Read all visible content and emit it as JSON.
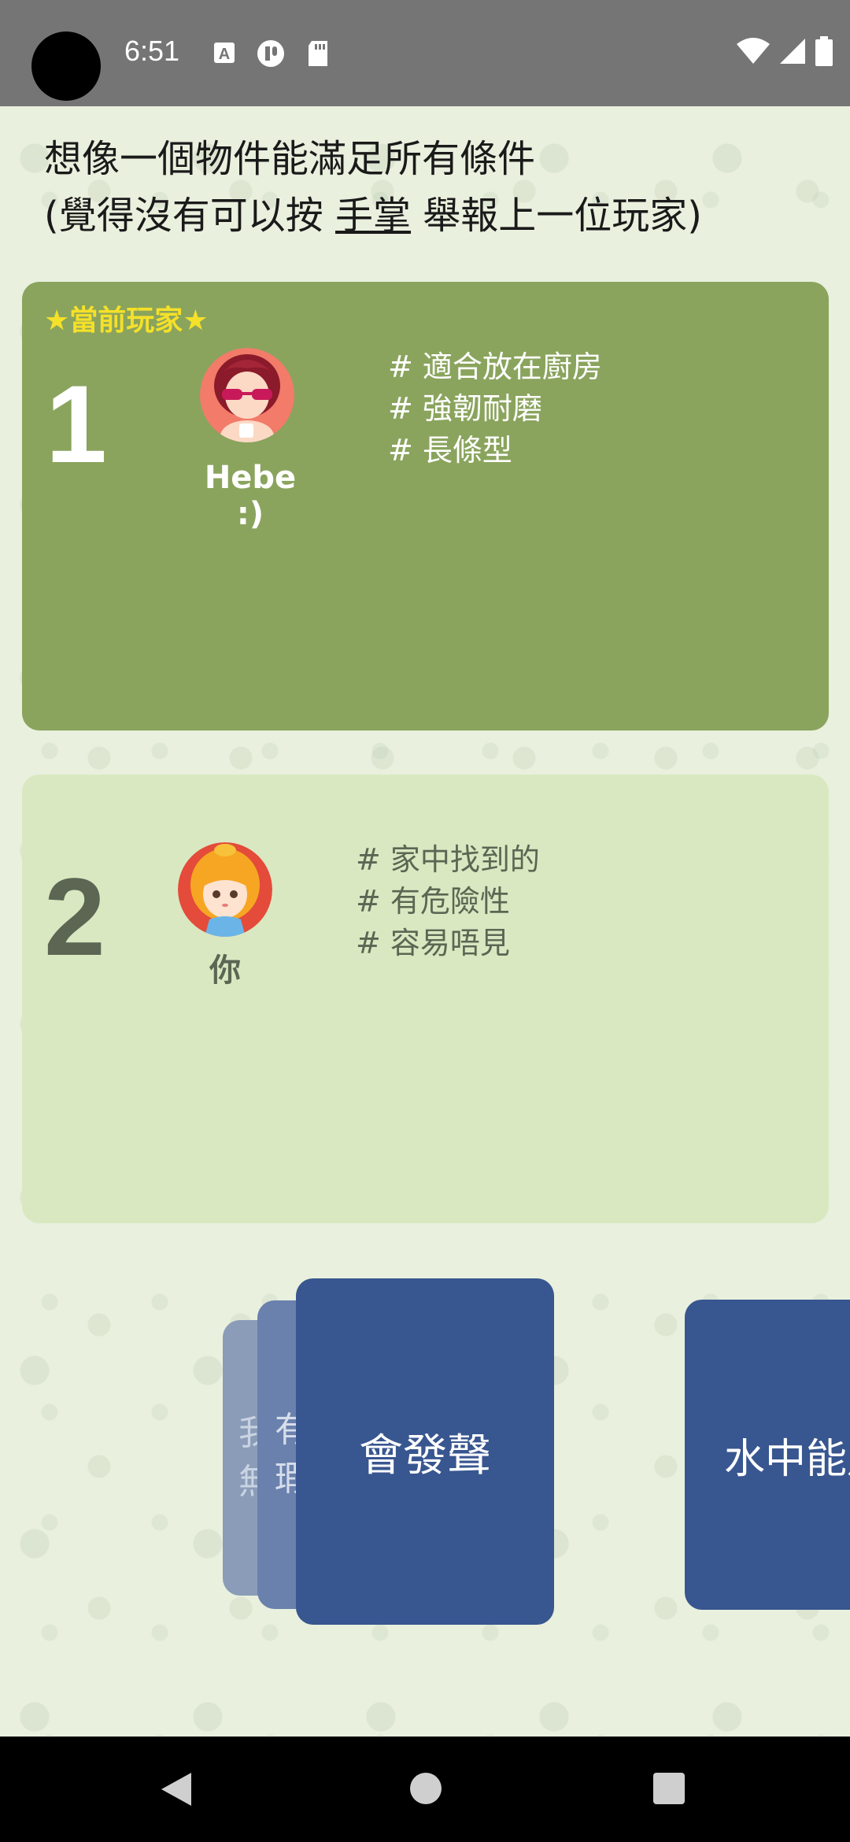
{
  "status_bar": {
    "time": "6:51",
    "left_icons": [
      "font-a-icon",
      "pause-circle-icon",
      "sd-card-icon"
    ],
    "right_icons": [
      "wifi-icon",
      "cellular-signal-icon",
      "battery-icon"
    ]
  },
  "instructions": {
    "line1": "想像一個物件能滿足所有條件",
    "line2_prefix": "(覺得沒有可以按 ",
    "line2_link": "手掌",
    "line2_suffix": " 舉報上一位玩家)"
  },
  "players": [
    {
      "tag": "★當前玩家★",
      "rank": "1",
      "name": "Hebe :)",
      "conditions": [
        "# 適合放在廚房",
        "# 強韌耐磨",
        "# 長條型"
      ]
    },
    {
      "rank": "2",
      "name": "你",
      "conditions": [
        "# 家中找到的",
        "# 有危險性",
        "# 容易唔見"
      ]
    }
  ],
  "cards": {
    "back2": [
      "我",
      "無"
    ],
    "back1": [
      "有",
      "瑕"
    ],
    "front": "會發聲",
    "right": "水中能用"
  },
  "colors": {
    "current_panel": "#8aa45d",
    "other_panel": "#d9e8c1",
    "card": "#38568f",
    "tag": "#f5e02a"
  }
}
